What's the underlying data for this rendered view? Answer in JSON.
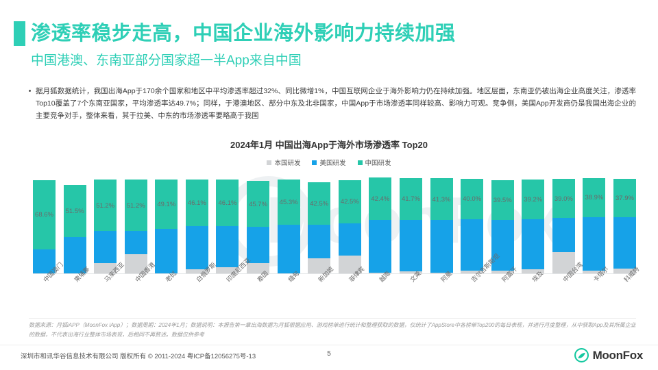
{
  "header": {
    "title": "渗透率稳步走高，中国企业海外影响力持续加强",
    "subtitle": "中国港澳、东南亚部分国家超一半App来自中国",
    "accent_color": "#2ecfb6"
  },
  "body": {
    "bullet": "据月狐数据统计，我国出海App于170余个国家和地区中平均渗透率超过32%、同比微增1%，中国互联网企业于海外影响力仍在持续加强。地区层面，东南亚仍被出海企业高度关注，渗透率Top10覆盖了7个东南亚国家，平均渗透率达49.7%；同样，于港澳地区、部分中东及北非国家，中国App于市场渗透率同样较高、影响力可观。竞争侧，美国App开发商仍是我国出海企业的主要竞争对手，整体来看，其于拉美、中东的市场渗透率要略高于我国"
  },
  "watermark": {
    "text": "MoonFox"
  },
  "chart_data": {
    "type": "bar",
    "subtype": "stacked-column",
    "title": "2024年1月 中国出海App于海外市场渗透率 Top20",
    "xlabel": "",
    "ylabel": "",
    "ylim": [
      0,
      100
    ],
    "grid": false,
    "legend_position": "top-center",
    "categories": [
      "中国澳门",
      "柬埔寨",
      "马来西亚",
      "中国香港",
      "老挝",
      "白俄罗斯",
      "印度尼西亚",
      "泰国",
      "缅甸",
      "新加坡",
      "菲律宾",
      "越南",
      "文莱",
      "阿曼",
      "吉尔吉斯斯坦",
      "阿富汗",
      "埃及",
      "中国台湾",
      "卡塔尔",
      "科威特"
    ],
    "data_labels": [
      "68.6%",
      "51.5%",
      "51.2%",
      "51.2%",
      "49.1%",
      "46.1%",
      "46.1%",
      "45.7%",
      "45.3%",
      "42.5%",
      "42.5%",
      "42.4%",
      "41.7%",
      "41.3%",
      "40.0%",
      "39.5%",
      "39.2%",
      "39.0%",
      "38.9%",
      "37.9%"
    ],
    "series": [
      {
        "name": "中国研发",
        "color": "#26c6a8",
        "values": [
          68.6,
          51.5,
          51.2,
          51.2,
          49.1,
          46.1,
          46.1,
          45.7,
          45.3,
          42.5,
          42.5,
          42.4,
          41.7,
          41.3,
          40.0,
          39.5,
          39.2,
          39.0,
          38.9,
          37.9
        ]
      },
      {
        "name": "美国研发",
        "color": "#16a2e8",
        "values": [
          24.0,
          36.0,
          32.0,
          23.0,
          44.0,
          43.0,
          41.0,
          36.0,
          48.0,
          33.0,
          32.0,
          52.0,
          51.0,
          52.0,
          51.0,
          50.0,
          50.0,
          34.0,
          53.0,
          51.0
        ]
      },
      {
        "name": "本国研发",
        "color": "#d2d4d6",
        "values": [
          0.0,
          0.0,
          10.0,
          19.0,
          0.0,
          4.0,
          6.0,
          10.0,
          0.0,
          15.0,
          18.0,
          1.0,
          2.0,
          1.0,
          3.0,
          3.0,
          4.0,
          21.0,
          3.0,
          5.0
        ]
      }
    ],
    "legend": [
      {
        "label": "本国研发",
        "color": "#d2d4d6"
      },
      {
        "label": "美国研发",
        "color": "#16a2e8"
      },
      {
        "label": "中国研发",
        "color": "#26c6a8"
      }
    ]
  },
  "footnote": {
    "text": "数据来源：月狐iAPP（MoonFox iApp）；数据周期：2024年1月；数据说明：本报告第一章出海数据为月狐根据应用、游戏榜单进行统计和整理获取的数据，仅统计了AppStore中各榜单Top200的每日表现，并进行月度整理，从中获取App及其所属企业的数据，不代表出海行业整体市场表现，后相同不再赘述。数据仅供参考"
  },
  "footer": {
    "copyright": "深圳市和讯华谷信息技术有限公司 版权所有 © 2011-2024 粤ICP备12056275号-13",
    "page_number": "5",
    "logo_text": "MoonFox"
  }
}
